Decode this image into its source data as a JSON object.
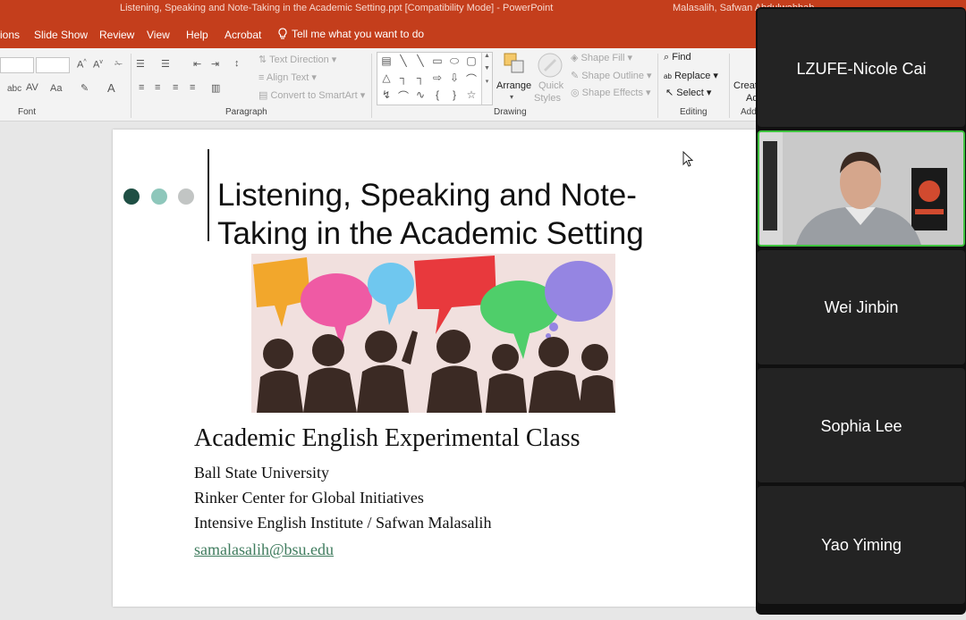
{
  "window": {
    "title": "Listening, Speaking and Note-Taking in the Academic Setting.ppt [Compatibility Mode]  -  PowerPoint",
    "user": "Malasalih, Safwan Abdulwahhab"
  },
  "ribbon_tabs": [
    "ions",
    "Slide Show",
    "Review",
    "View",
    "Help",
    "Acrobat"
  ],
  "tell_me": "Tell me what you want to do",
  "ribbon": {
    "groups": [
      "Font",
      "Paragraph",
      "Drawing",
      "Editing",
      "Add"
    ],
    "paragraph": {
      "text_direction": "Text Direction",
      "align_text": "Align Text",
      "convert_smartart": "Convert to SmartArt"
    },
    "drawing": {
      "arrange": "Arrange",
      "quick_styles_1": "Quick",
      "quick_styles_2": "Styles",
      "shape_fill": "Shape Fill",
      "shape_outline": "Shape Outline",
      "shape_effects": "Shape Effects"
    },
    "editing": {
      "find": "Find",
      "replace": "Replace",
      "select": "Select"
    },
    "create_1": "Creat",
    "create_2": "Ad"
  },
  "slide": {
    "title": "Listening, Speaking and Note-Taking in the Academic Setting",
    "subtitle": "Academic English Experimental Class",
    "lines": [
      "Ball State University",
      "Rinker Center for Global Initiatives",
      "Intensive English Institute / Safwan Malasalih"
    ],
    "email": "samalasalih@bsu.edu",
    "dot_colors": [
      "#1f4f44",
      "#8ec7bb",
      "#c2c5c4"
    ]
  },
  "participants": [
    {
      "name": "LZUFE-Nicole Cai",
      "video": false
    },
    {
      "name": "",
      "video": true
    },
    {
      "name": "Wei Jinbin",
      "video": false
    },
    {
      "name": "Sophia Lee",
      "video": false
    },
    {
      "name": "Yao Yiming",
      "video": false
    }
  ],
  "colors": {
    "ribbon_accent": "#c43e1c",
    "active_speaker": "#3ec33e",
    "link": "#3f7c5e"
  }
}
